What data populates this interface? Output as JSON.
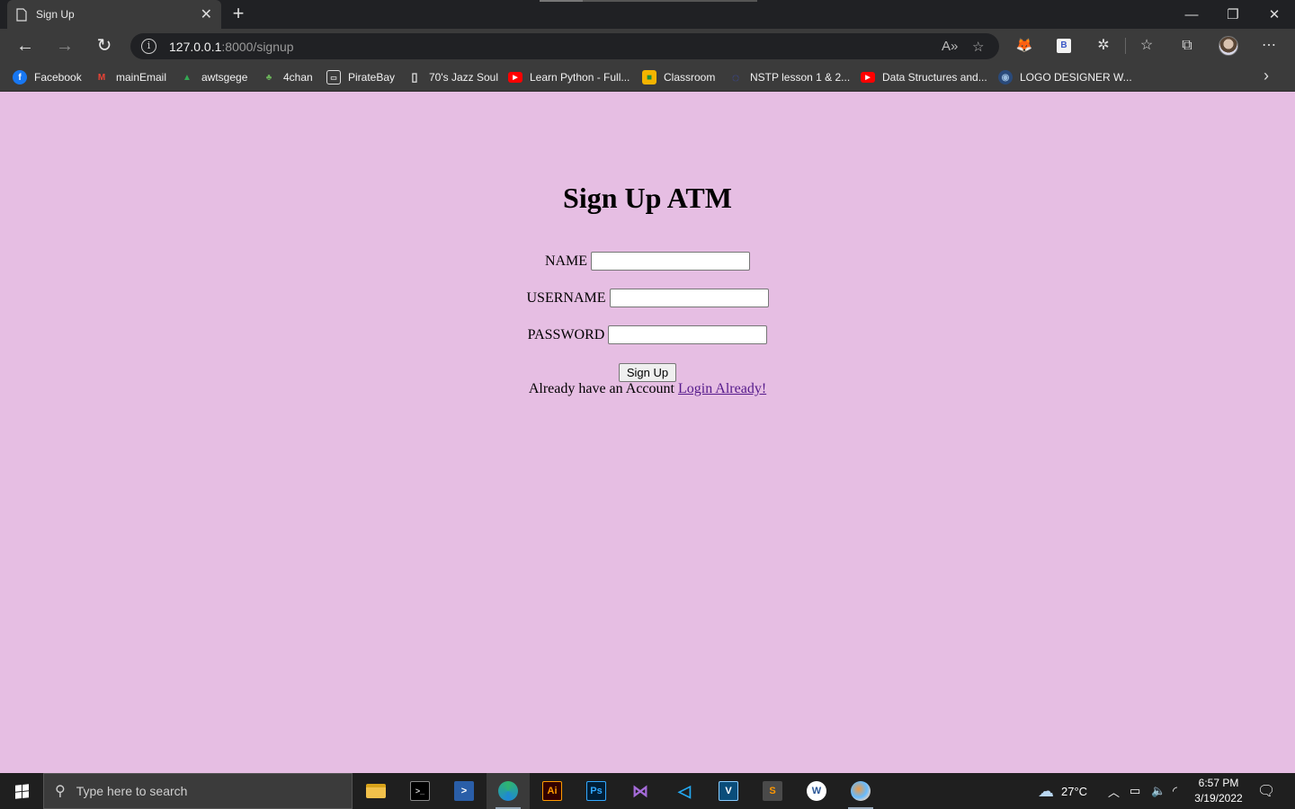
{
  "browser": {
    "tab_title": "Sign Up",
    "url_host": "127.0.0.1",
    "url_rest": ":8000/signup",
    "bookmarks": [
      {
        "label": "Facebook",
        "icon": "facebook-icon"
      },
      {
        "label": "mainEmail",
        "icon": "gmail-icon"
      },
      {
        "label": "awtsgege",
        "icon": "google-drive-icon"
      },
      {
        "label": "4chan",
        "icon": "clover-icon"
      },
      {
        "label": "PirateBay",
        "icon": "terminal-icon"
      },
      {
        "label": "70's Jazz Soul",
        "icon": "page-icon"
      },
      {
        "label": "Learn Python - Full...",
        "icon": "youtube-icon"
      },
      {
        "label": "Classroom",
        "icon": "classroom-icon"
      },
      {
        "label": "NSTP lesson 1 & 2...",
        "icon": "globe-icon"
      },
      {
        "label": "Data Structures and...",
        "icon": "youtube-icon"
      },
      {
        "label": "LOGO DESIGNER W...",
        "icon": "logo-icon"
      }
    ]
  },
  "page": {
    "title": "Sign Up ATM",
    "name_label": "NAME",
    "username_label": "USERNAME",
    "password_label": "PASSWORD",
    "name_value": "",
    "username_value": "",
    "password_value": "",
    "submit_label": "Sign Up",
    "login_prompt": "Already have an Account",
    "login_link": "Login Already!"
  },
  "taskbar": {
    "search_placeholder": "Type here to search",
    "weather": "27°C",
    "time": "6:57 PM",
    "date": "3/19/2022",
    "apps": [
      "file-explorer-icon",
      "terminal-icon",
      "powershell-icon",
      "edge-icon",
      "illustrator-icon",
      "photoshop-icon",
      "visual-studio-icon",
      "vscode-icon",
      "vim-icon",
      "sublime-icon",
      "word-icon",
      "paint-icon"
    ]
  },
  "colors": {
    "page_background": "#e6bee3",
    "link_visited": "#551a8b",
    "chrome_dark": "#3b3b3b"
  }
}
